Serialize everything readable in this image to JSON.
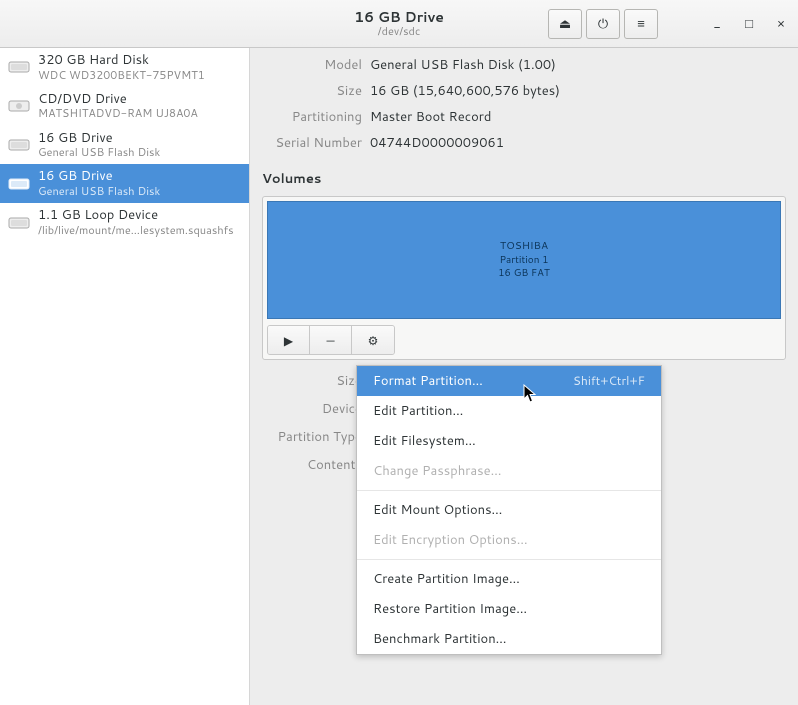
{
  "header": {
    "title": "16 GB Drive",
    "subtitle": "/dev/sdc"
  },
  "devices": [
    {
      "title": "320 GB Hard Disk",
      "sub": "WDC WD3200BEKT-75PVMT1",
      "selected": false
    },
    {
      "title": "CD/DVD Drive",
      "sub": "MATSHITADVD-RAM UJ8A0A",
      "selected": false
    },
    {
      "title": "16 GB Drive",
      "sub": "General USB Flash Disk",
      "selected": false
    },
    {
      "title": "16 GB Drive",
      "sub": "General USB Flash Disk",
      "selected": true
    },
    {
      "title": "1.1 GB Loop Device",
      "sub": "/lib/live/mount/me…lesystem.squashfs",
      "selected": false
    }
  ],
  "props": {
    "model_label": "Model",
    "model_value": "General USB Flash Disk (1.00)",
    "size_label": "Size",
    "size_value": "16 GB (15,640,600,576 bytes)",
    "partitioning_label": "Partitioning",
    "partitioning_value": "Master Boot Record",
    "serial_label": "Serial Number",
    "serial_value": "04744D0000009061"
  },
  "volumes": {
    "section_title": "Volumes",
    "block_name": "TOSHIBA",
    "block_partition": "Partition 1",
    "block_size": "16 GB FAT"
  },
  "lower": {
    "size_label": "Size",
    "device_label": "Device",
    "partition_type_label": "Partition Type",
    "contents_label": "Contents"
  },
  "menu": {
    "format_partition": "Format Partition…",
    "format_accel": "Shift+Ctrl+F",
    "edit_partition": "Edit Partition…",
    "edit_filesystem": "Edit Filesystem…",
    "change_passphrase": "Change Passphrase…",
    "edit_mount": "Edit Mount Options…",
    "edit_encryption": "Edit Encryption Options…",
    "create_image": "Create Partition Image…",
    "restore_image": "Restore Partition Image…",
    "benchmark": "Benchmark Partition…"
  },
  "icons": {
    "eject": "⏏",
    "power": "⏻",
    "menu": "≡",
    "minimize": "_",
    "maximize": "□",
    "close": "×",
    "play": "▶",
    "minus": "—",
    "gear": "⚙"
  }
}
